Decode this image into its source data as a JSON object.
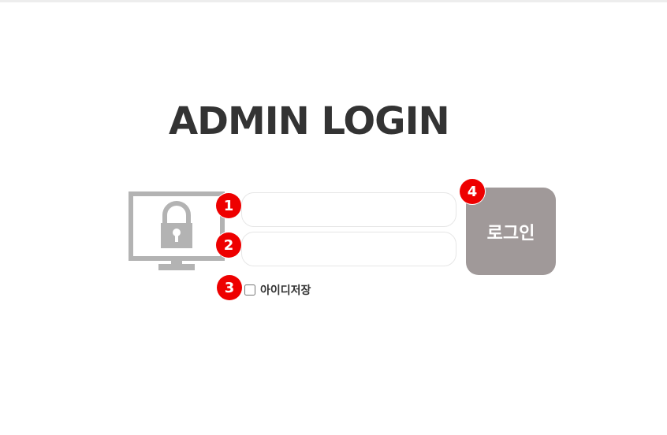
{
  "page": {
    "title": "ADMIN LOGIN"
  },
  "form": {
    "id_value": "",
    "id_placeholder": "",
    "password_value": "",
    "password_placeholder": "",
    "remember_label": "아이디저장",
    "remember_checked": false,
    "login_label": "로그인"
  },
  "badges": {
    "b1": "1",
    "b2": "2",
    "b3": "3",
    "b4": "4"
  },
  "icons": {
    "monitor": "monitor-lock-icon"
  },
  "colors": {
    "title": "#333333",
    "button_bg": "#a09999",
    "badge_bg": "#ee0000",
    "icon_gray": "#b3b3b3"
  }
}
